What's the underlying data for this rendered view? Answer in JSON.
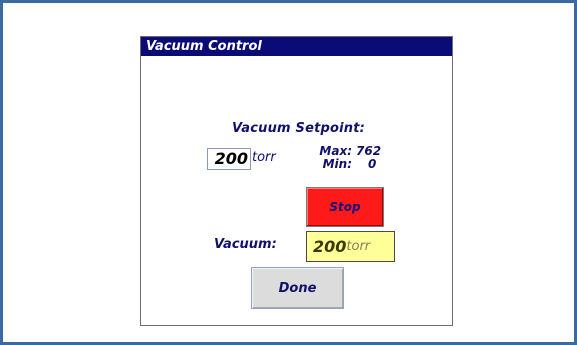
{
  "dialog": {
    "title": "Vacuum Control"
  },
  "setpoint": {
    "heading": "Vacuum Setpoint:",
    "value": "200",
    "unit": "torr",
    "max_label": "Max:",
    "max_value": "762",
    "min_label": "Min:",
    "min_value": "0"
  },
  "controls": {
    "stop_label": "Stop",
    "done_label": "Done"
  },
  "vacuum": {
    "label": "Vacuum:",
    "value": "200",
    "unit": "torr"
  },
  "colors": {
    "frame_border": "#3b6aa0",
    "titlebar": "#0b0b78",
    "stop_button": "#ff1a1a",
    "readout_background": "#ffff99",
    "done_button": "#dcdcdc",
    "label_text": "#11116b"
  }
}
